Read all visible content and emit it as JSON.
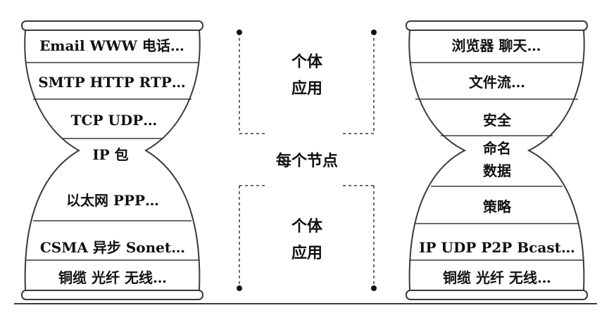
{
  "left_hourglass": {
    "layers": [
      "Email WWW  电话…",
      "SMTP HTTP RTP…",
      "TCP UDP…",
      "IP 包",
      "以太网  PPP…",
      "CSMA  异步  Sonet…",
      "铜缆  光纤  无线…"
    ]
  },
  "right_hourglass": {
    "layers": [
      "浏览器  聊天…",
      "文件流…",
      "安全",
      "命名",
      "数据",
      "策略",
      "IP UDP P2P Bcast…",
      "铜缆  光纤  无线…"
    ]
  },
  "center": {
    "top_label_line1": "个体",
    "top_label_line2": "应用",
    "middle_label": "每个节点",
    "bottom_label_line1": "个体",
    "bottom_label_line2": "应用"
  },
  "colors": {
    "stroke": "#3a3a3a",
    "text": "#111111",
    "background": "#ffffff"
  }
}
